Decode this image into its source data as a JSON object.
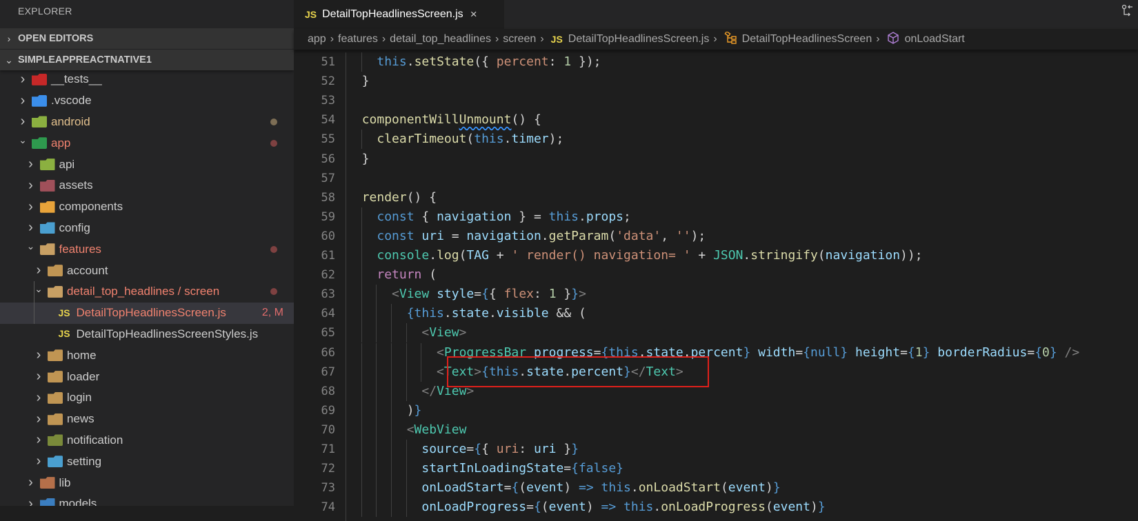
{
  "sidebar": {
    "title": "EXPLORER",
    "sections": [
      {
        "label": "OPEN EDITORS",
        "expanded": false
      },
      {
        "label": "SIMPLEAPPREACTNATIVE1",
        "expanded": true
      }
    ],
    "tree": [
      {
        "label": "__tests__",
        "depth": 0,
        "chevron": "right",
        "icon": "test-folder-icon",
        "icon_color": "#c62828",
        "color": "#cccccc"
      },
      {
        "label": ".vscode",
        "depth": 0,
        "chevron": "right",
        "icon": "vscode-folder-icon",
        "icon_color": "#3b8eea",
        "color": "#cccccc"
      },
      {
        "label": "android",
        "depth": 0,
        "chevron": "right",
        "icon": "android-folder-icon",
        "icon_color": "#8bb040",
        "color": "#e2c08d",
        "dot": "#7d6e55"
      },
      {
        "label": "app",
        "depth": 0,
        "chevron": "down",
        "icon": "app-folder-icon",
        "icon_color": "#2e9a4e",
        "color": "#f0826f",
        "dot": "#7e4141"
      },
      {
        "label": "api",
        "depth": 1,
        "chevron": "right",
        "icon": "api-folder-icon",
        "icon_color": "#8bb040",
        "color": "#cccccc"
      },
      {
        "label": "assets",
        "depth": 1,
        "chevron": "right",
        "icon": "assets-folder-icon",
        "icon_color": "#a0505a",
        "color": "#cccccc"
      },
      {
        "label": "components",
        "depth": 1,
        "chevron": "right",
        "icon": "components-folder-icon",
        "icon_color": "#e8a33a",
        "color": "#cccccc"
      },
      {
        "label": "config",
        "depth": 1,
        "chevron": "right",
        "icon": "config-folder-icon",
        "icon_color": "#4a9fd0",
        "color": "#cccccc"
      },
      {
        "label": "features",
        "depth": 1,
        "chevron": "down",
        "icon": "folder-open-icon",
        "icon_color": "#c8a064",
        "color": "#f0826f",
        "dot": "#7e4141"
      },
      {
        "label": "account",
        "depth": 2,
        "chevron": "right",
        "icon": "folder-icon",
        "icon_color": "#c09553",
        "color": "#cccccc"
      },
      {
        "label": "detail_top_headlines / screen",
        "depth": 2,
        "chevron": "down",
        "icon": "folder-open-icon",
        "icon_color": "#c8a064",
        "color": "#f0826f",
        "dot": "#7e4141"
      },
      {
        "label": "DetailTopHeadlinesScreen.js",
        "depth": 3,
        "chevron": "",
        "icon": "js-file-icon",
        "color": "#f0826f",
        "badge": "2, M",
        "selected": true
      },
      {
        "label": "DetailTopHeadlinesScreenStyles.js",
        "depth": 3,
        "chevron": "",
        "icon": "js-file-icon",
        "color": "#cccccc"
      },
      {
        "label": "home",
        "depth": 2,
        "chevron": "right",
        "icon": "folder-icon",
        "icon_color": "#c09553",
        "color": "#cccccc"
      },
      {
        "label": "loader",
        "depth": 2,
        "chevron": "right",
        "icon": "folder-icon",
        "icon_color": "#c09553",
        "color": "#cccccc"
      },
      {
        "label": "login",
        "depth": 2,
        "chevron": "right",
        "icon": "folder-icon",
        "icon_color": "#c09553",
        "color": "#cccccc"
      },
      {
        "label": "news",
        "depth": 2,
        "chevron": "right",
        "icon": "folder-icon",
        "icon_color": "#c09553",
        "color": "#cccccc"
      },
      {
        "label": "notification",
        "depth": 2,
        "chevron": "right",
        "icon": "notification-folder-icon",
        "icon_color": "#7a8a3a",
        "color": "#cccccc"
      },
      {
        "label": "setting",
        "depth": 2,
        "chevron": "right",
        "icon": "setting-folder-icon",
        "icon_color": "#4a9fd0",
        "color": "#cccccc"
      },
      {
        "label": "lib",
        "depth": 1,
        "chevron": "right",
        "icon": "lib-folder-icon",
        "icon_color": "#b5704a",
        "color": "#cccccc"
      },
      {
        "label": "models",
        "depth": 1,
        "chevron": "right",
        "icon": "models-folder-icon",
        "icon_color": "#3b7ec0",
        "color": "#cccccc"
      }
    ]
  },
  "tab": {
    "badge": "JS",
    "label": "DetailTopHeadlinesScreen.js",
    "close": "×"
  },
  "breadcrumb": {
    "items": [
      "app",
      "features",
      "detail_top_headlines",
      "screen"
    ],
    "file_badge": "JS",
    "file": "DetailTopHeadlinesScreen.js",
    "class": "DetailTopHeadlinesScreen",
    "method": "onLoadStart",
    "separator": "›"
  },
  "editor": {
    "lines": [
      {
        "n": "51",
        "tokens": [
          [
            "    ",
            "p"
          ],
          [
            "this",
            "k"
          ],
          [
            ".",
            "p"
          ],
          [
            "setState",
            "f"
          ],
          [
            "({ ",
            "p"
          ],
          [
            "percent",
            "o"
          ],
          [
            ": ",
            "p"
          ],
          [
            "1",
            "n"
          ],
          [
            " });",
            "p"
          ]
        ]
      },
      {
        "n": "52",
        "tokens": [
          [
            "  }",
            "p"
          ]
        ]
      },
      {
        "n": "53",
        "tokens": []
      },
      {
        "n": "54",
        "tokens": [
          [
            "  ",
            "p"
          ],
          [
            "componentWill",
            "f"
          ],
          [
            "Unmount",
            "f w"
          ],
          [
            "() {",
            "p"
          ]
        ]
      },
      {
        "n": "55",
        "tokens": [
          [
            "    ",
            "p"
          ],
          [
            "clearTimeout",
            "f"
          ],
          [
            "(",
            "p"
          ],
          [
            "this",
            "k"
          ],
          [
            ".",
            "p"
          ],
          [
            "timer",
            "v"
          ],
          [
            ");",
            "p"
          ]
        ]
      },
      {
        "n": "56",
        "tokens": [
          [
            "  }",
            "p"
          ]
        ]
      },
      {
        "n": "57",
        "tokens": []
      },
      {
        "n": "58",
        "tokens": [
          [
            "  ",
            "p"
          ],
          [
            "render",
            "f"
          ],
          [
            "() {",
            "p"
          ]
        ]
      },
      {
        "n": "59",
        "tokens": [
          [
            "    ",
            "p"
          ],
          [
            "const",
            "k"
          ],
          [
            " { ",
            "p"
          ],
          [
            "navigation",
            "v"
          ],
          [
            " } = ",
            "p"
          ],
          [
            "this",
            "k"
          ],
          [
            ".",
            "p"
          ],
          [
            "props",
            "v"
          ],
          [
            ";",
            "p"
          ]
        ]
      },
      {
        "n": "60",
        "tokens": [
          [
            "    ",
            "p"
          ],
          [
            "const",
            "k"
          ],
          [
            " ",
            "p"
          ],
          [
            "uri",
            "v"
          ],
          [
            " = ",
            "p"
          ],
          [
            "navigation",
            "v"
          ],
          [
            ".",
            "p"
          ],
          [
            "getParam",
            "f"
          ],
          [
            "(",
            "p"
          ],
          [
            "'data'",
            "s"
          ],
          [
            ", ",
            "p"
          ],
          [
            "''",
            "s"
          ],
          [
            ");",
            "p"
          ]
        ]
      },
      {
        "n": "61",
        "tokens": [
          [
            "    ",
            "p"
          ],
          [
            "console",
            "t"
          ],
          [
            ".",
            "p"
          ],
          [
            "log",
            "f"
          ],
          [
            "(",
            "p"
          ],
          [
            "TAG",
            "v"
          ],
          [
            " + ",
            "p"
          ],
          [
            "' render() navigation= '",
            "s"
          ],
          [
            " + ",
            "p"
          ],
          [
            "JSON",
            "t"
          ],
          [
            ".",
            "p"
          ],
          [
            "stringify",
            "f"
          ],
          [
            "(",
            "p"
          ],
          [
            "navigation",
            "v"
          ],
          [
            "));",
            "p"
          ]
        ]
      },
      {
        "n": "62",
        "tokens": [
          [
            "    ",
            "p"
          ],
          [
            "return",
            "c"
          ],
          [
            " (",
            "p"
          ]
        ]
      },
      {
        "n": "63",
        "tokens": [
          [
            "      ",
            "p"
          ],
          [
            "<",
            "g"
          ],
          [
            "View",
            "t"
          ],
          [
            " ",
            "p"
          ],
          [
            "style",
            "v"
          ],
          [
            "=",
            "p"
          ],
          [
            "{",
            "k"
          ],
          [
            "{ ",
            "p"
          ],
          [
            "flex",
            "o"
          ],
          [
            ": ",
            "p"
          ],
          [
            "1",
            "n"
          ],
          [
            " }",
            "p"
          ],
          [
            "}",
            "k"
          ],
          [
            ">",
            "g"
          ]
        ]
      },
      {
        "n": "64",
        "tokens": [
          [
            "        ",
            "p"
          ],
          [
            "{",
            "k"
          ],
          [
            "this",
            "k"
          ],
          [
            ".",
            "p"
          ],
          [
            "state",
            "v"
          ],
          [
            ".",
            "p"
          ],
          [
            "visible",
            "v"
          ],
          [
            " && (",
            "p"
          ]
        ]
      },
      {
        "n": "65",
        "tokens": [
          [
            "          ",
            "p"
          ],
          [
            "<",
            "g"
          ],
          [
            "View",
            "t"
          ],
          [
            ">",
            "g"
          ]
        ]
      },
      {
        "n": "66",
        "tokens": [
          [
            "            ",
            "p"
          ],
          [
            "<",
            "g"
          ],
          [
            "ProgressBar",
            "t"
          ],
          [
            " ",
            "p"
          ],
          [
            "progress",
            "v"
          ],
          [
            "=",
            "p"
          ],
          [
            "{",
            "k"
          ],
          [
            "this",
            "k"
          ],
          [
            ".",
            "p"
          ],
          [
            "state",
            "v"
          ],
          [
            ".",
            "p"
          ],
          [
            "percent",
            "v"
          ],
          [
            "}",
            "k"
          ],
          [
            " ",
            "p"
          ],
          [
            "width",
            "v"
          ],
          [
            "=",
            "p"
          ],
          [
            "{",
            "k"
          ],
          [
            "null",
            "k"
          ],
          [
            "}",
            "k"
          ],
          [
            " ",
            "p"
          ],
          [
            "height",
            "v"
          ],
          [
            "=",
            "p"
          ],
          [
            "{",
            "k"
          ],
          [
            "1",
            "n"
          ],
          [
            "}",
            "k"
          ],
          [
            " ",
            "p"
          ],
          [
            "borderRadius",
            "v"
          ],
          [
            "=",
            "p"
          ],
          [
            "{",
            "k"
          ],
          [
            "0",
            "n"
          ],
          [
            "}",
            "k"
          ],
          [
            " />",
            "g"
          ]
        ]
      },
      {
        "n": "67",
        "tokens": [
          [
            "            ",
            "p"
          ],
          [
            "<",
            "g"
          ],
          [
            "Text",
            "t"
          ],
          [
            ">",
            "g"
          ],
          [
            "{",
            "k"
          ],
          [
            "this",
            "k"
          ],
          [
            ".",
            "p"
          ],
          [
            "state",
            "v"
          ],
          [
            ".",
            "p"
          ],
          [
            "percent",
            "v"
          ],
          [
            "}",
            "k"
          ],
          [
            "</",
            "g"
          ],
          [
            "Text",
            "t"
          ],
          [
            ">",
            "g"
          ]
        ]
      },
      {
        "n": "68",
        "tokens": [
          [
            "          ",
            "p"
          ],
          [
            "</",
            "g"
          ],
          [
            "View",
            "t"
          ],
          [
            ">",
            "g"
          ]
        ]
      },
      {
        "n": "69",
        "tokens": [
          [
            "        ",
            "p"
          ],
          [
            ")",
            "p"
          ],
          [
            "}",
            "k"
          ]
        ]
      },
      {
        "n": "70",
        "tokens": [
          [
            "        ",
            "p"
          ],
          [
            "<",
            "g"
          ],
          [
            "WebView",
            "t"
          ]
        ]
      },
      {
        "n": "71",
        "tokens": [
          [
            "          ",
            "p"
          ],
          [
            "source",
            "v"
          ],
          [
            "=",
            "p"
          ],
          [
            "{",
            "k"
          ],
          [
            "{ ",
            "p"
          ],
          [
            "uri",
            "o"
          ],
          [
            ": ",
            "p"
          ],
          [
            "uri",
            "v"
          ],
          [
            " }",
            "p"
          ],
          [
            "}",
            "k"
          ]
        ]
      },
      {
        "n": "72",
        "tokens": [
          [
            "          ",
            "p"
          ],
          [
            "startInLoadingState",
            "v"
          ],
          [
            "=",
            "p"
          ],
          [
            "{",
            "k"
          ],
          [
            "false",
            "k"
          ],
          [
            "}",
            "k"
          ]
        ]
      },
      {
        "n": "73",
        "tokens": [
          [
            "          ",
            "p"
          ],
          [
            "onLoadStart",
            "v"
          ],
          [
            "=",
            "p"
          ],
          [
            "{",
            "k"
          ],
          [
            "(",
            "p"
          ],
          [
            "event",
            "v"
          ],
          [
            ")",
            "p"
          ],
          [
            " => ",
            "k"
          ],
          [
            "this",
            "k"
          ],
          [
            ".",
            "p"
          ],
          [
            "onLoadStart",
            "f"
          ],
          [
            "(",
            "p"
          ],
          [
            "event",
            "v"
          ],
          [
            ")",
            "p"
          ],
          [
            "}",
            "k"
          ]
        ]
      },
      {
        "n": "74",
        "tokens": [
          [
            "          ",
            "p"
          ],
          [
            "onLoadProgress",
            "v"
          ],
          [
            "=",
            "p"
          ],
          [
            "{",
            "k"
          ],
          [
            "(",
            "p"
          ],
          [
            "event",
            "v"
          ],
          [
            ")",
            "p"
          ],
          [
            " => ",
            "k"
          ],
          [
            "this",
            "k"
          ],
          [
            ".",
            "p"
          ],
          [
            "onLoadProgress",
            "f"
          ],
          [
            "(",
            "p"
          ],
          [
            "event",
            "v"
          ],
          [
            ")",
            "p"
          ],
          [
            "}",
            "k"
          ]
        ]
      }
    ]
  }
}
